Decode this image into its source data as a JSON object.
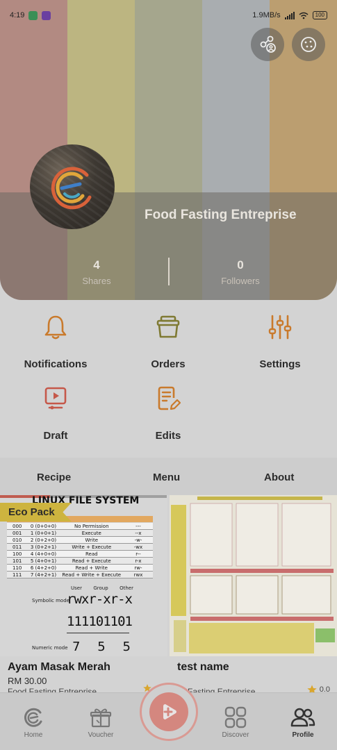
{
  "status_bar": {
    "time": "4:19",
    "network_speed": "1.9MB/s",
    "battery": "100"
  },
  "header": {
    "stripe_colors": [
      "#b28a82",
      "#bcb581",
      "#a5a68d",
      "#a9adb0",
      "#bb9e70"
    ],
    "share_icon": "share-profile-icon",
    "cookie_icon": "cookie-icon"
  },
  "profile": {
    "name": "Food Fasting Entreprise",
    "shares_count": "4",
    "shares_label": "Shares",
    "followers_count": "0",
    "followers_label": "Followers"
  },
  "actions": [
    {
      "label": "Notifications",
      "icon": "bell-icon",
      "color": "#c97a2c"
    },
    {
      "label": "Orders",
      "icon": "basket-icon",
      "color": "#7f7a33"
    },
    {
      "label": "Settings",
      "icon": "sliders-icon",
      "color": "#c97a2c"
    },
    {
      "label": "Draft",
      "icon": "video-draft-icon",
      "color": "#c5584a"
    },
    {
      "label": "Edits",
      "icon": "edit-document-icon",
      "color": "#c97a2c"
    }
  ],
  "tabs": [
    "Recipe",
    "Menu",
    "About"
  ],
  "cards": [
    {
      "badge": "Eco Pack",
      "title": "Ayam Masak Merah",
      "price": "RM 30.00",
      "store": "Food Fasting Entreprise",
      "image": {
        "heading": "LINUX FILE SYSTEM",
        "table_rows": [
          [
            "000",
            "0 (0+0+0)",
            "No Permission",
            "---"
          ],
          [
            "001",
            "1 (0+0+1)",
            "Execute",
            "--x"
          ],
          [
            "010",
            "2 (0+2+0)",
            "Write",
            "-w-"
          ],
          [
            "011",
            "3 (0+2+1)",
            "Write + Execute",
            "-wx"
          ],
          [
            "100",
            "4 (4+0+0)",
            "Read",
            "r--"
          ],
          [
            "101",
            "5 (4+0+1)",
            "Read + Execute",
            "r-x"
          ],
          [
            "110",
            "6 (4+2+0)",
            "Read + Write",
            "rw-"
          ],
          [
            "111",
            "7 (4+2+1)",
            "Read + Write + Execute",
            "rwx"
          ]
        ],
        "group_labels": [
          "User",
          "Group",
          "Other"
        ],
        "symbolic_label": "Symbolic mode",
        "symbolic_value": "rwxr-xr-x",
        "binary_value": "111101101",
        "numeric_label": "Numeric mode",
        "numeric_digits": [
          "7",
          "5",
          "5"
        ]
      }
    },
    {
      "title": "test name",
      "store": "d Fasting Entreprise",
      "rating": "0.0"
    }
  ],
  "bottom_nav": [
    {
      "label": "Home",
      "icon": "home-logo-icon"
    },
    {
      "label": "Voucher",
      "icon": "gift-icon"
    },
    {
      "label": "Discover",
      "icon": "grid-icon"
    },
    {
      "label": "Profile",
      "icon": "people-icon"
    }
  ],
  "fab_icon": "add-play-icon"
}
